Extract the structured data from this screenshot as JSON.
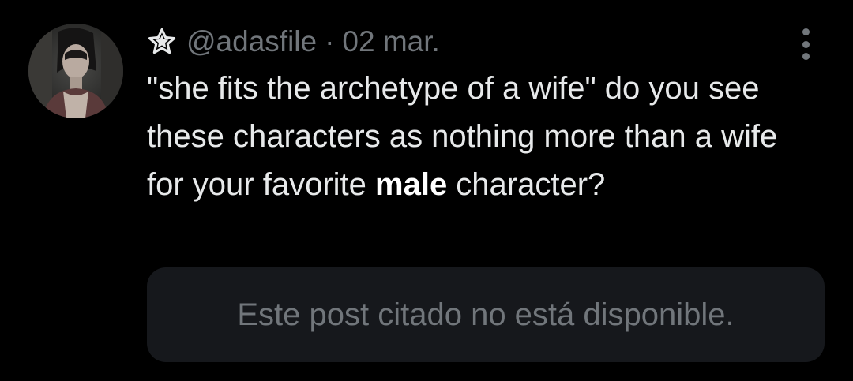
{
  "post": {
    "handle": "@adasfile",
    "separator": "·",
    "date": "02 mar.",
    "text_part1": "\"she fits the archetype of a wife\" do you see these characters as nothing more than a wife for your favorite ",
    "text_bold": "male",
    "text_part2": " character?",
    "quoted_unavailable": "Este post citado no está disponible."
  },
  "icons": {
    "badge": "star-icon",
    "menu": "more-vertical-icon"
  },
  "colors": {
    "background": "#000000",
    "text_primary": "#e7e9ea",
    "text_secondary": "#71767b",
    "quote_bg": "#16181c"
  }
}
